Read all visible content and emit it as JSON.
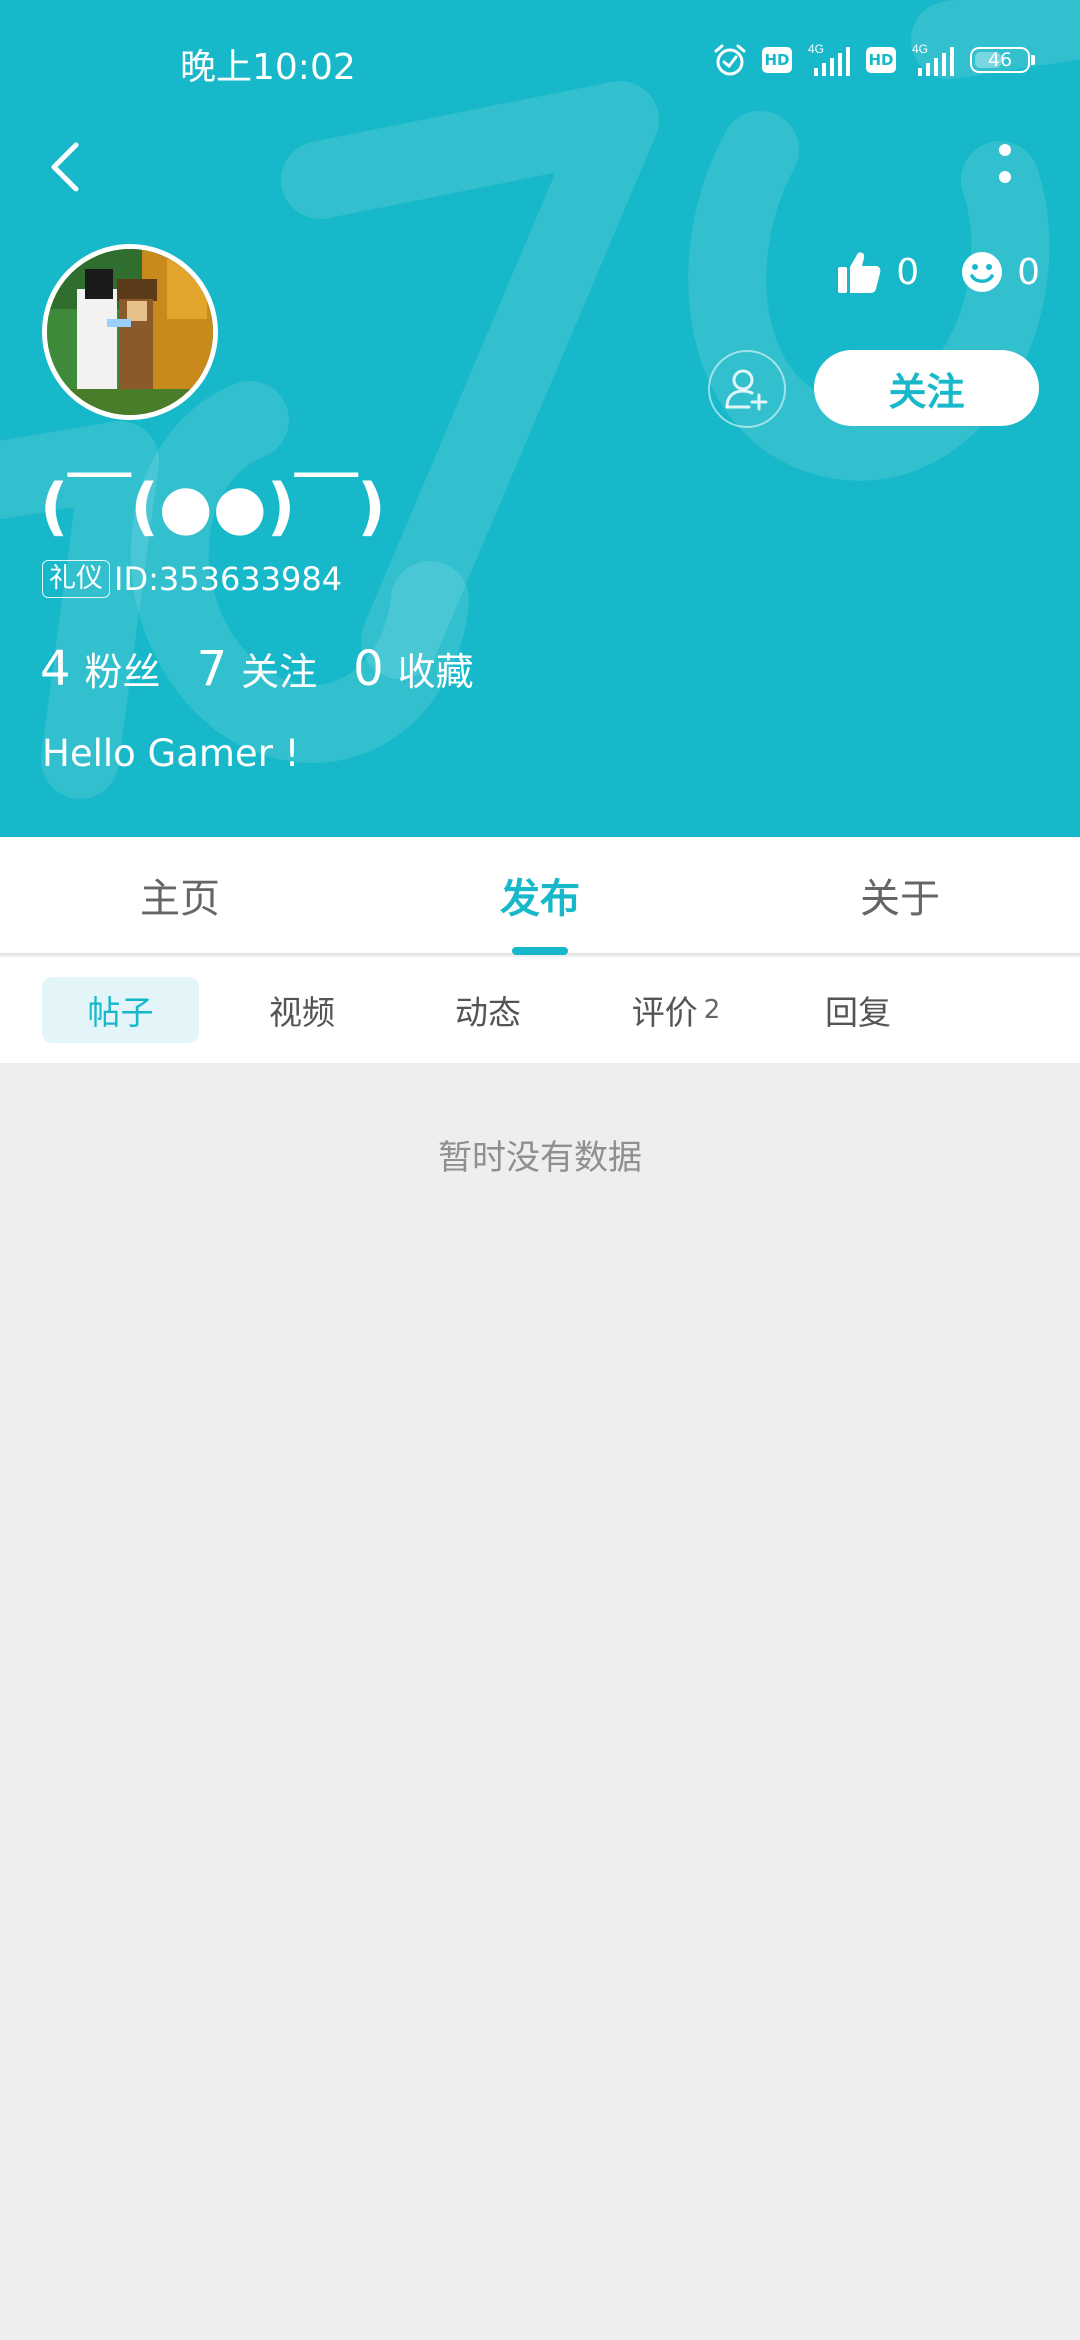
{
  "status_bar": {
    "time": "晚上10:02",
    "hd_label_1": "HD",
    "network_1": "4G",
    "hd_label_2": "HD",
    "network_2": "4G",
    "battery": "46"
  },
  "profile": {
    "likes_count": "0",
    "smile_count": "0",
    "follow_label": "关注",
    "username": "(￣(●●)￣)",
    "badge": "礼仪",
    "id_text": "ID:353633984",
    "fans_count": "4",
    "fans_label": "粉丝",
    "following_count": "7",
    "following_label": "关注",
    "favorites_count": "0",
    "favorites_label": "收藏",
    "bio": "Hello Gamer !"
  },
  "main_tabs": [
    {
      "label": "主页"
    },
    {
      "label": "发布"
    },
    {
      "label": "关于"
    }
  ],
  "active_main_tab": "发布",
  "sub_tabs": [
    {
      "label": "帖子",
      "count": ""
    },
    {
      "label": "视频",
      "count": ""
    },
    {
      "label": "动态",
      "count": ""
    },
    {
      "label": "评价",
      "count": "2"
    },
    {
      "label": "回复",
      "count": ""
    }
  ],
  "active_sub_tab": "帖子",
  "empty_state": "暂时没有数据",
  "colors": {
    "accent": "#16b8c9",
    "background": "#eeeeee",
    "active_subtab_bg": "#e3f5f8"
  }
}
